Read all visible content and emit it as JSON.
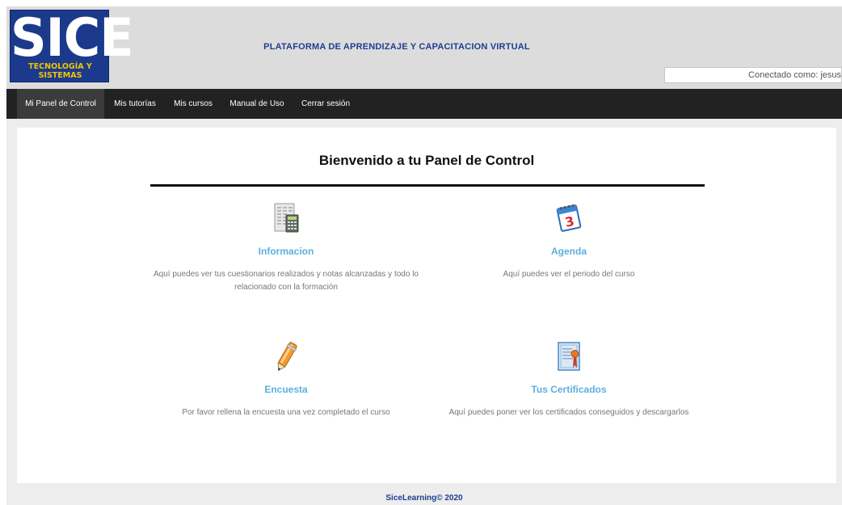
{
  "header": {
    "logo_big": "SICE",
    "logo_small": "TECNOLOGÍA Y SISTEMAS",
    "title": "PLATAFORMA DE APRENDIZAJE Y CAPACITACION VIRTUAL",
    "user": "Conectado como: jesus"
  },
  "nav": {
    "items": [
      {
        "label": "Mi Panel de Control"
      },
      {
        "label": "Mis tutorías"
      },
      {
        "label": "Mis cursos"
      },
      {
        "label": "Manual de Uso"
      },
      {
        "label": "Cerrar sesión"
      }
    ]
  },
  "main": {
    "welcome": "Bienvenido a tu Panel de Control",
    "cards": [
      {
        "title": "Informacion",
        "desc": "Aquí puedes ver tus cuestionarios realizados y notas alcanzadas y todo lo relacionado con la formación",
        "icon": "calculator-icon"
      },
      {
        "title": "Agenda",
        "desc": "Aquí puedes ver el periodo del curso",
        "icon": "calendar-icon"
      },
      {
        "title": "Encuesta",
        "desc": "Por favor rellena la encuesta una vez completado el curso",
        "icon": "pen-icon"
      },
      {
        "title": "Tus Certificados",
        "desc": "Aquí puedes poner ver los certificados conseguidos y descargarlos",
        "icon": "certificate-icon"
      }
    ]
  },
  "footer": {
    "text": "SiceLearning© 2020"
  },
  "colors": {
    "nav_bg": "#222222",
    "accent_title": "#5bb0dd",
    "header_title": "#1e3d8f"
  }
}
